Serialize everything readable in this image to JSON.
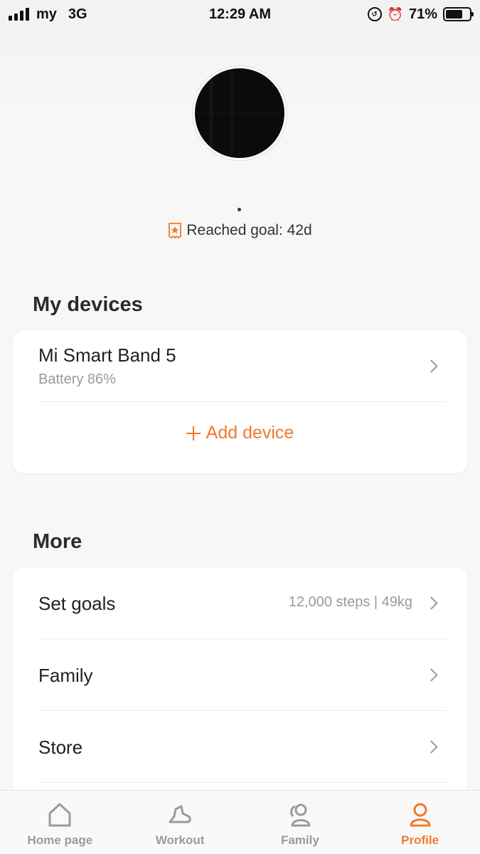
{
  "status_bar": {
    "carrier": "my",
    "network": "3G",
    "time": "12:29 AM",
    "battery_percent_text": "71%",
    "battery_level": 0.71
  },
  "profile": {
    "goal_text": "Reached goal: 42d"
  },
  "devices_section": {
    "title": "My devices",
    "device_name": "Mi Smart Band 5",
    "device_battery": "Battery 86%",
    "add_label": "Add device"
  },
  "more_section": {
    "title": "More",
    "items": [
      {
        "label": "Set goals",
        "value": "12,000 steps | 49kg"
      },
      {
        "label": "Family",
        "value": ""
      },
      {
        "label": "Store",
        "value": ""
      }
    ]
  },
  "tabs": [
    {
      "label": "Home page",
      "icon": "home-icon"
    },
    {
      "label": "Workout",
      "icon": "shoe-icon"
    },
    {
      "label": "Family",
      "icon": "family-icon"
    },
    {
      "label": "Profile",
      "icon": "profile-icon",
      "active": true
    }
  ],
  "colors": {
    "accent": "#f07a2b",
    "muted": "#9a9a9a",
    "background": "#f7f7f7"
  }
}
